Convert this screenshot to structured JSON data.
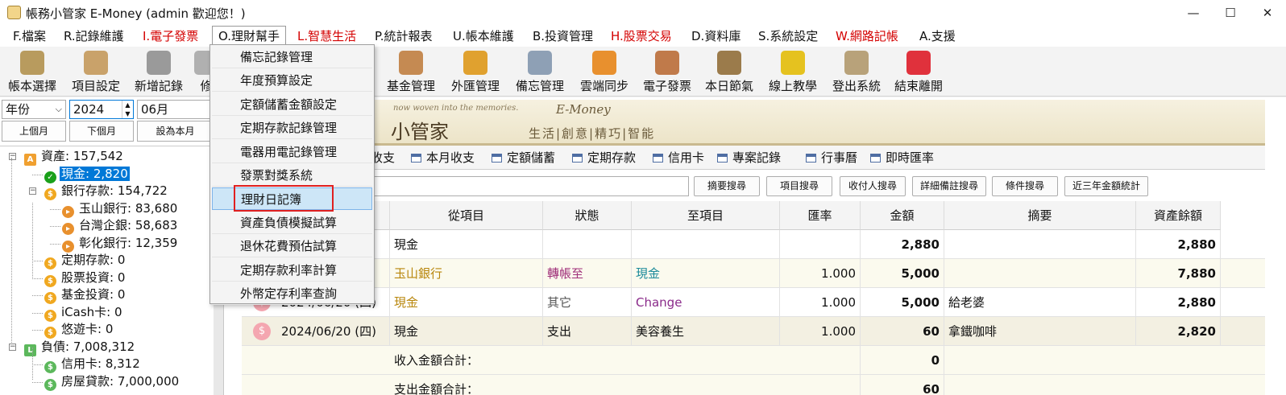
{
  "window": {
    "title": "帳務小管家 E-Money (admin 歡迎您！)",
    "minimize_glyph": "—",
    "maximize_glyph": "☐",
    "close_glyph": "✕"
  },
  "menu": [
    {
      "label": "F.檔案",
      "red": false
    },
    {
      "label": "R.記錄維護",
      "red": false
    },
    {
      "label": "I.電子發票",
      "red": true
    },
    {
      "label": "O.理財幫手",
      "red": false
    },
    {
      "label": "L.智慧生活",
      "red": true
    },
    {
      "label": "P.統計報表",
      "red": false
    },
    {
      "label": "U.帳本維護",
      "red": false
    },
    {
      "label": "B.投資管理",
      "red": false
    },
    {
      "label": "H.股票交易",
      "red": true
    },
    {
      "label": "D.資料庫",
      "red": false
    },
    {
      "label": "S.系統設定",
      "red": false
    },
    {
      "label": "W.網路記帳",
      "red": true
    },
    {
      "label": "A.支援",
      "red": false
    }
  ],
  "toolbar": [
    {
      "label": "帳本選擇",
      "icon": "ledger-book-icon",
      "color": "#b89b5e"
    },
    {
      "label": "項目設定",
      "icon": "item-settings-icon",
      "color": "#c9a26a"
    },
    {
      "label": "新增記錄",
      "icon": "add-record-icon",
      "color": "#9a9a9a"
    },
    {
      "label": "修",
      "icon": "edit-icon",
      "color": "#b0b0b0"
    },
    {
      "label": "基金管理",
      "icon": "fund-icon",
      "color": "#c58a52"
    },
    {
      "label": "外匯管理",
      "icon": "forex-icon",
      "color": "#e0a12f"
    },
    {
      "label": "備忘管理",
      "icon": "memo-icon",
      "color": "#8ea0b5"
    },
    {
      "label": "雲端同步",
      "icon": "cloud-sync-icon",
      "color": "#e8902e"
    },
    {
      "label": "電子發票",
      "icon": "qr-invoice-icon",
      "color": "#c07a4a"
    },
    {
      "label": "本日節氣",
      "icon": "solar-term-icon",
      "color": "#9b7b4b"
    },
    {
      "label": "線上教學",
      "icon": "help-icon",
      "color": "#e5c21f"
    },
    {
      "label": "登出系統",
      "icon": "logout-icon",
      "color": "#b8a27a"
    },
    {
      "label": "結束離開",
      "icon": "exit-icon",
      "color": "#e0313c"
    }
  ],
  "left": {
    "period_type": "年份",
    "year": "2024",
    "month": "06月",
    "prev_month": "上個月",
    "next_month": "下個月",
    "set_this_month": "設為本月"
  },
  "tree": [
    {
      "label": "資產: 157,542",
      "level": 0,
      "icon": "A",
      "icon_color": "#f0a030",
      "square": true,
      "expander": "−",
      "selected": false
    },
    {
      "label": "現金: 2,820",
      "level": 1,
      "icon": "✓",
      "icon_color": "#1aa01a",
      "square": false,
      "selected": true
    },
    {
      "label": "銀行存款: 154,722",
      "level": 1,
      "icon": "$",
      "icon_color": "#f0a820",
      "square": false,
      "expander": "−",
      "selected": false
    },
    {
      "label": "玉山銀行: 83,680",
      "level": 2,
      "icon": "▸",
      "icon_color": "#e8902e",
      "square": false,
      "selected": false
    },
    {
      "label": "台灣企銀: 58,683",
      "level": 2,
      "icon": "▸",
      "icon_color": "#e8902e",
      "square": false,
      "selected": false
    },
    {
      "label": "彰化銀行: 12,359",
      "level": 2,
      "icon": "▸",
      "icon_color": "#e8902e",
      "square": false,
      "selected": false
    },
    {
      "label": "定期存款: 0",
      "level": 1,
      "icon": "$",
      "icon_color": "#f0a820",
      "square": false,
      "selected": false
    },
    {
      "label": "股票投資: 0",
      "level": 1,
      "icon": "$",
      "icon_color": "#f0a820",
      "square": false,
      "selected": false
    },
    {
      "label": "基金投資: 0",
      "level": 1,
      "icon": "$",
      "icon_color": "#f0a820",
      "square": false,
      "selected": false
    },
    {
      "label": "iCash卡: 0",
      "level": 1,
      "icon": "$",
      "icon_color": "#f0a820",
      "square": false,
      "selected": false
    },
    {
      "label": "悠遊卡: 0",
      "level": 1,
      "icon": "$",
      "icon_color": "#f0a820",
      "square": false,
      "selected": false
    },
    {
      "label": "負債: 7,008,312",
      "level": 0,
      "icon": "L",
      "icon_color": "#5cb85c",
      "square": true,
      "expander": "−",
      "selected": false
    },
    {
      "label": "信用卡: 8,312",
      "level": 1,
      "icon": "$",
      "icon_color": "#5cb85c",
      "square": false,
      "selected": false
    },
    {
      "label": "房屋貸款: 7,000,000",
      "level": 1,
      "icon": "$",
      "icon_color": "#5cb85c",
      "square": false,
      "selected": false
    }
  ],
  "banner": {
    "tagline": "now woven into the memories.",
    "brand": "E-Money",
    "title": "小管家",
    "slogan": "生活|創意|精巧|智能"
  },
  "tabs": [
    "收支",
    "本月收支",
    "定額儲蓄",
    "定期存款",
    "信用卡",
    "專案記錄",
    "行事曆",
    "即時匯率"
  ],
  "search_buttons": [
    "摘要搜尋",
    "項目搜尋",
    "收付人搜尋",
    "詳細備註搜尋",
    "條件搜尋",
    "近三年金額統計"
  ],
  "grid": {
    "headers": [
      "從項目",
      "狀態",
      "至項目",
      "匯率",
      "金額",
      "摘要",
      "資產餘額"
    ],
    "rows": [
      {
        "date": "",
        "from": "現金",
        "status": "",
        "to": "",
        "rate": "",
        "amount": "2,880",
        "memo": "",
        "balance": "2,880",
        "bg": "#ffffff",
        "from_color": "#111",
        "status_color": "#111",
        "to_color": "#111",
        "icon": ""
      },
      {
        "date": "",
        "from": "玉山銀行",
        "status": "轉帳至",
        "to": "現金",
        "rate": "1.000",
        "amount": "5,000",
        "memo": "",
        "balance": "7,880",
        "bg": "#fbfaee",
        "from_color": "#b8860b",
        "status_color": "#a0307a",
        "to_color": "#1a8a9a",
        "icon": ""
      },
      {
        "date": "2024/06/20 (四)",
        "from": "現金",
        "status": "其它",
        "to": "Change",
        "rate": "1.000",
        "amount": "5,000",
        "memo": "給老婆",
        "balance": "2,880",
        "bg": "#ffffff",
        "from_color": "#b8860b",
        "status_color": "#555",
        "to_color": "#8a2a8a",
        "icon": "$"
      },
      {
        "date": "2024/06/20 (四)",
        "from": "現金",
        "status": "支出",
        "to": "美容養生",
        "rate": "1.000",
        "amount": "60",
        "memo": "拿鐵咖啡",
        "balance": "2,820",
        "bg": "#f3f0e2",
        "from_color": "#111",
        "status_color": "#111",
        "to_color": "#111",
        "icon": "$"
      }
    ],
    "income_total_label": "收入金額合計：",
    "income_total": "0",
    "expense_total_label": "支出金額合計：",
    "expense_total": "60"
  },
  "dropdown": {
    "items": [
      "備忘記錄管理",
      "年度預算設定",
      "定額儲蓄金額設定",
      "定期存款記錄管理",
      "電器用電記錄管理",
      "發票對獎系統",
      "理財日記簿",
      "資產負債模擬試算",
      "退休花費預估試算",
      "定期存款利率計算",
      "外幣定存利率查詢"
    ],
    "highlighted_index": 6
  }
}
